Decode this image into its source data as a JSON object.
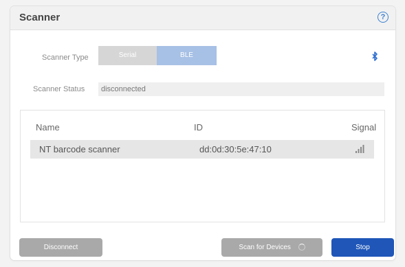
{
  "header": {
    "title": "Scanner",
    "help_icon": "question-circle-icon",
    "help_glyph": "?"
  },
  "scanner_type": {
    "label": "Scanner Type",
    "options": [
      "Serial",
      "BLE"
    ],
    "selected": "BLE",
    "status_icon": "bluetooth-icon"
  },
  "scanner_status": {
    "label": "Scanner Status",
    "value": "disconnected"
  },
  "devices": {
    "columns": [
      "Name",
      "ID",
      "Signal"
    ],
    "rows": [
      {
        "name": "NT barcode scanner",
        "id": "dd:0d:30:5e:47:10",
        "signal_icon": "signal-strength-icon"
      }
    ]
  },
  "buttons": {
    "disconnect": "Disconnect",
    "scan": "Scan for Devices",
    "stop": "Stop"
  },
  "colors": {
    "accent": "#1f56b8",
    "selected_segment": "#a7c0e5",
    "disabled": "#a9a9a9"
  }
}
